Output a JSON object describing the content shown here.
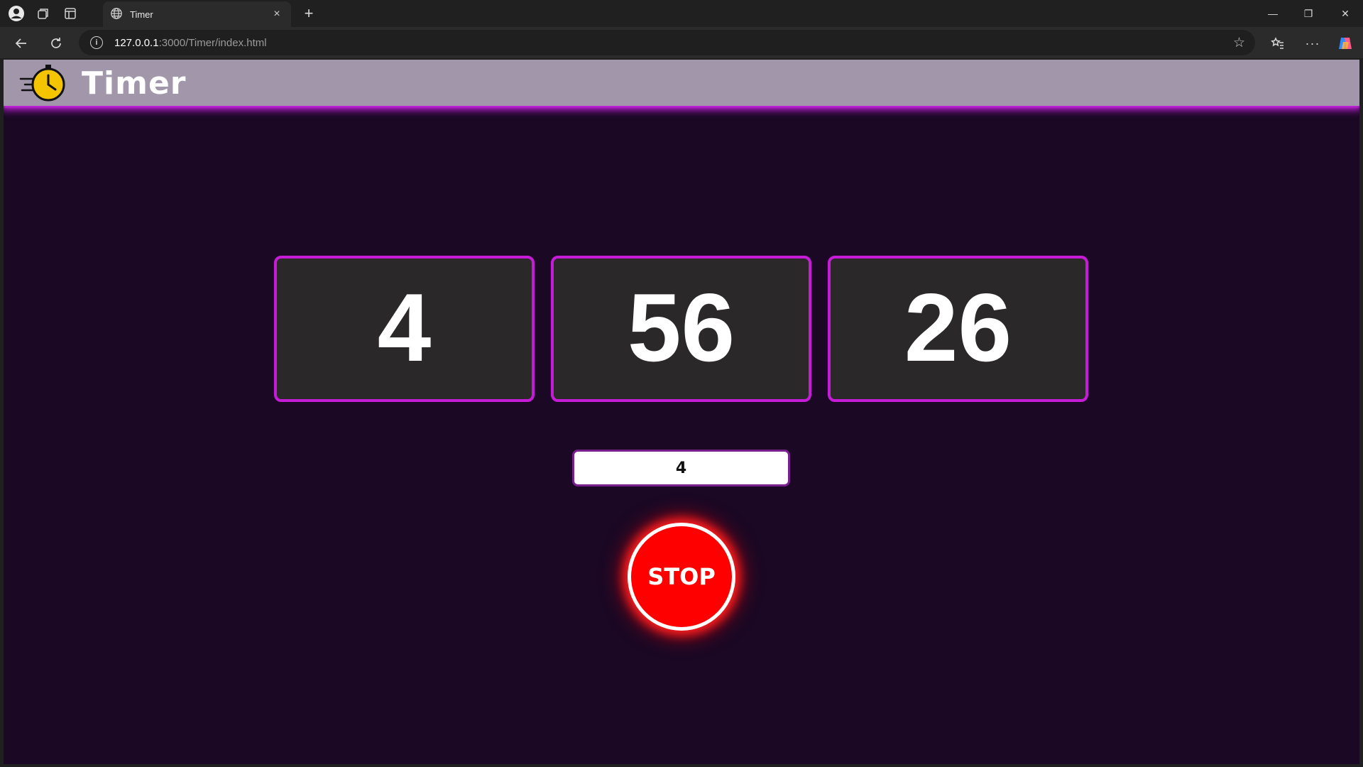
{
  "browser": {
    "tab_title": "Timer",
    "tab_close": "×",
    "new_tab": "+",
    "url_host": "127.0.0.1",
    "url_path": ":3000/Timer/index.html",
    "window_controls": {
      "minimize": "—",
      "restore": "❐",
      "close": "✕"
    }
  },
  "header": {
    "title": "Timer",
    "logo_icon": "stopwatch-icon"
  },
  "timer": {
    "hours": "4",
    "minutes": "56",
    "seconds": "26"
  },
  "input": {
    "value": "4"
  },
  "controls": {
    "stop_label": "STOP"
  },
  "colors": {
    "page_bg": "#1a0824",
    "header_bg": "#a196aa",
    "accent": "#c61cd8",
    "stop": "#ff0000"
  }
}
